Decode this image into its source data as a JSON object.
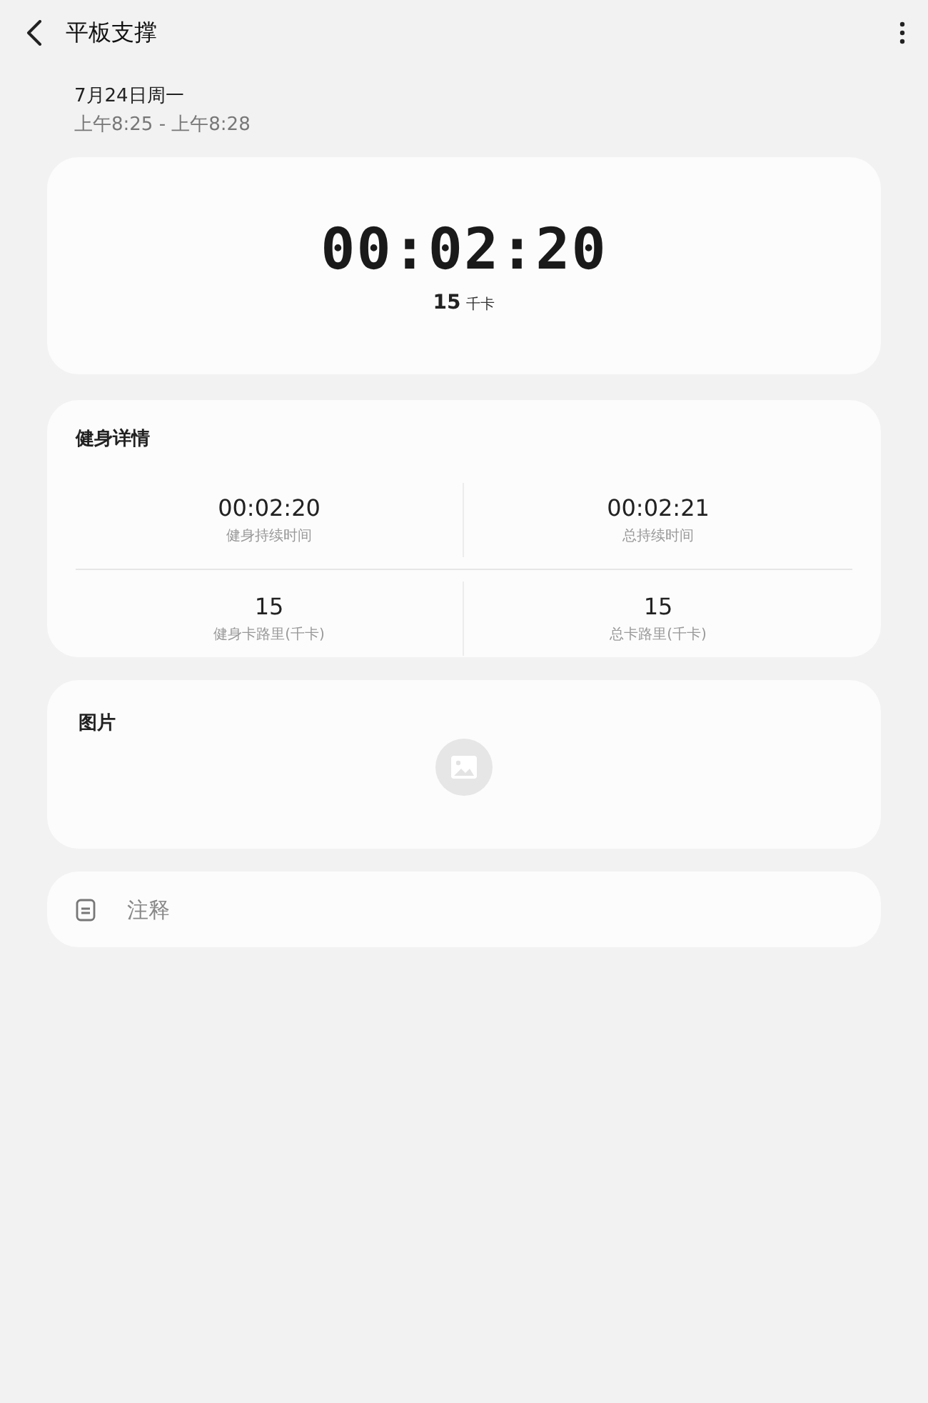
{
  "header": {
    "title": "平板支撑"
  },
  "session": {
    "date": "7月24日周一",
    "time_range": "上午8:25 - 上午8:28"
  },
  "summary": {
    "timer": "00:02:20",
    "calories": "15",
    "calories_unit": "千卡"
  },
  "details": {
    "title": "健身详情",
    "stats": [
      {
        "value": "00:02:20",
        "label": "健身持续时间"
      },
      {
        "value": "00:02:21",
        "label": "总持续时间"
      },
      {
        "value": "15",
        "label": "健身卡路里(千卡)"
      },
      {
        "value": "15",
        "label": "总卡路里(千卡)"
      }
    ]
  },
  "pictures": {
    "title": "图片"
  },
  "notes": {
    "placeholder": "注释"
  }
}
